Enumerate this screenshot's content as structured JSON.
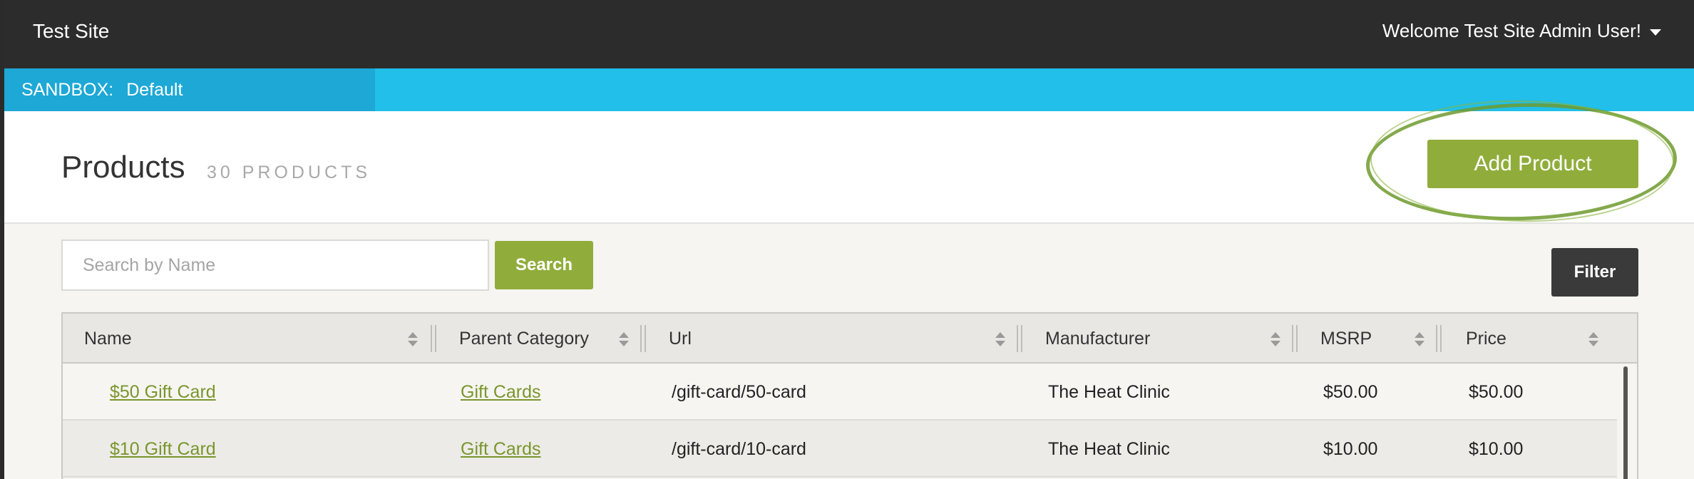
{
  "topbar": {
    "site_title": "Test Site",
    "welcome": "Welcome Test Site Admin User!"
  },
  "sandbox": {
    "label": "SANDBOX:",
    "value": "Default"
  },
  "header": {
    "title": "Products",
    "count": "30 PRODUCTS",
    "add_button": "Add Product"
  },
  "search": {
    "placeholder": "Search by Name",
    "value": "",
    "button": "Search"
  },
  "filter_button": "Filter",
  "table": {
    "columns": [
      "Name",
      "Parent Category",
      "Url",
      "Manufacturer",
      "MSRP",
      "Price"
    ],
    "rows": [
      {
        "name": "$50 Gift Card",
        "parent_category": "Gift Cards",
        "url": "/gift-card/50-card",
        "manufacturer": "The Heat Clinic",
        "msrp": "$50.00",
        "price": "$50.00"
      },
      {
        "name": "$10 Gift Card",
        "parent_category": "Gift Cards",
        "url": "/gift-card/10-card",
        "manufacturer": "The Heat Clinic",
        "msrp": "$10.00",
        "price": "$10.00"
      }
    ]
  },
  "colors": {
    "topbar": "#2c2c2c",
    "sandbox_bar": "#21bfe9",
    "accent_green": "#90ad3b",
    "annotation_circle": "#6f9a2e",
    "link": "#7a962c"
  },
  "icons": {
    "user_menu": "caret-down-icon",
    "sort": "sort-arrows-icon"
  }
}
